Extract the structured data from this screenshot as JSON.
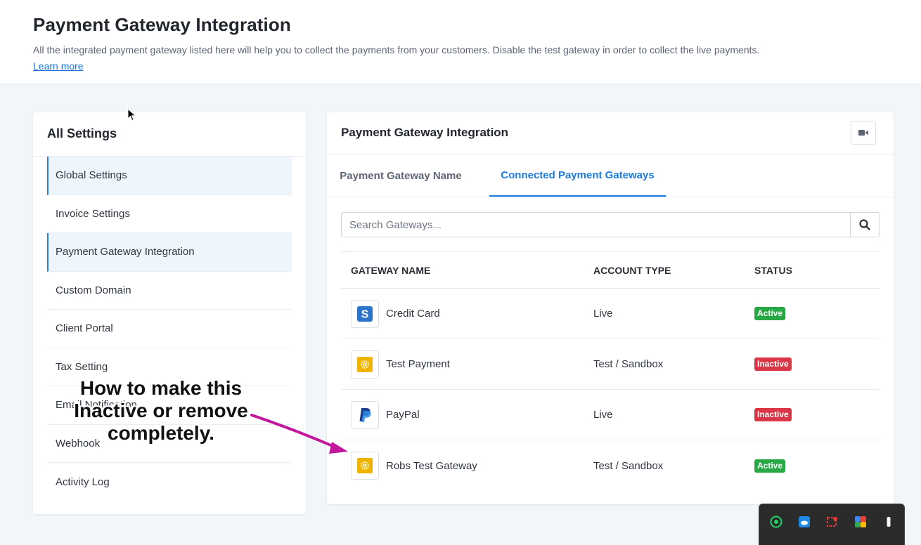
{
  "header": {
    "title": "Payment Gateway Integration",
    "description": "All the integrated payment gateway listed here will help you to collect the payments from your customers. Disable the test gateway in order to collect the live payments.",
    "learn_more": "Learn more"
  },
  "settings": {
    "title": "All Settings",
    "items": [
      {
        "label": "Global Settings"
      },
      {
        "label": "Invoice Settings"
      },
      {
        "label": "Payment Gateway Integration"
      },
      {
        "label": "Custom Domain"
      },
      {
        "label": "Client Portal"
      },
      {
        "label": "Tax Setting"
      },
      {
        "label": "Email Notification"
      },
      {
        "label": "Webhook"
      },
      {
        "label": "Activity Log"
      }
    ]
  },
  "panel": {
    "title": "Payment Gateway Integration",
    "tabs": [
      {
        "label": "Payment Gateway Name"
      },
      {
        "label": "Connected Payment Gateways"
      }
    ],
    "search": {
      "placeholder": "Search Gateways...",
      "value": ""
    },
    "table": {
      "headers": [
        "GATEWAY NAME",
        "ACCOUNT TYPE",
        "STATUS"
      ],
      "rows": [
        {
          "name": "Credit Card",
          "type": "Live",
          "status": "Active",
          "logo": "stripe-icon"
        },
        {
          "name": "Test Payment",
          "type": "Test / Sandbox",
          "status": "Inactive",
          "logo": "gear-icon"
        },
        {
          "name": "PayPal",
          "type": "Live",
          "status": "Inactive",
          "logo": "paypal-icon"
        },
        {
          "name": "Robs Test Gateway",
          "type": "Test / Sandbox",
          "status": "Active",
          "logo": "gear-icon"
        }
      ]
    }
  },
  "annotation": {
    "line1": "How to make this",
    "line2": "Inactive or remove",
    "line3": "completely."
  },
  "colors": {
    "accent": "#1b7be0",
    "active": "#28a745",
    "inactive": "#dc3545",
    "arrow": "#c2189b"
  }
}
